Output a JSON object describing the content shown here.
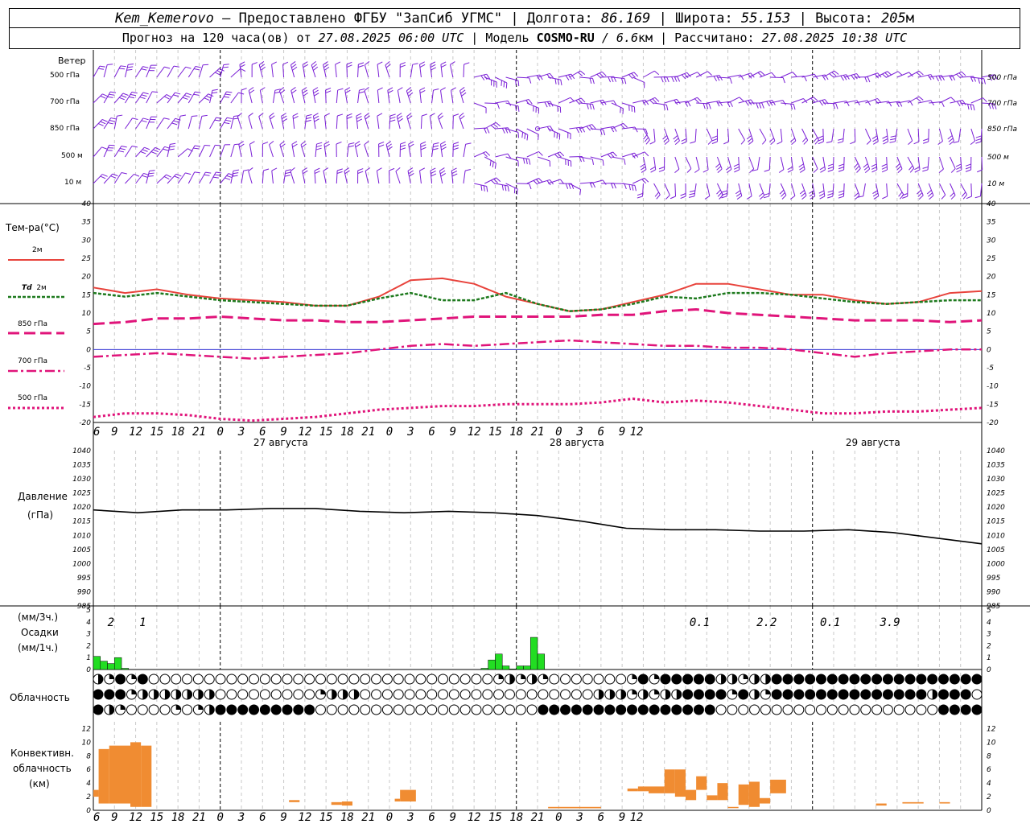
{
  "header": {
    "line1": {
      "station": "Kem_Kemerovo",
      "provider": " — Предоставлено ФГБУ \"ЗапСиб УГМС\" | Долгота: ",
      "lon": "86.169",
      "lat_label": " | Широта: ",
      "lat": "55.153",
      "alt_label": " | Высота: ",
      "alt": "205",
      "alt_unit": "м"
    },
    "line2": {
      "forecast_label": "Прогноз на 120 часа(ов) от ",
      "start": "27.08.2025 06:00 UTC",
      "model_label": " | Модель ",
      "model": "COSMO-RU",
      "res": " / 6.6",
      "res_unit": "км",
      "calc_label": " | Рассчитано: ",
      "calc": "27.08.2025 10:38 UTC"
    }
  },
  "labels": {
    "wind": "Ветер",
    "wind_levels": [
      "500 гПа",
      "700 гПа",
      "850 гПа",
      "500 м",
      "10 м"
    ],
    "temp": "Тем-ра(°C)",
    "t2m": "2м",
    "td": "Td",
    "td2m": "2м",
    "t850": "850 гПа",
    "t700": "700 гПа",
    "t500": "500 гПа",
    "pressure": "Давление",
    "pressure_unit": "(гПа)",
    "precip_unit3": "(мм/3ч.)",
    "precip": "Осадки",
    "precip_unit1": "(мм/1ч.)",
    "cloud": "Облачность",
    "conv1": "Конвективн.",
    "conv2": "облачность",
    "conv3": "(км)"
  },
  "x_ticks": [
    "6",
    "9",
    "12",
    "15",
    "18",
    "21",
    "0",
    "3",
    "6",
    "9",
    "12",
    "15",
    "18",
    "21",
    "0",
    "3",
    "6",
    "9",
    "12",
    "15",
    "18",
    "21",
    "0",
    "3",
    "6",
    "9",
    "12"
  ],
  "dates": [
    "27 августа",
    "28 августа",
    "29 августа"
  ],
  "colors": {
    "wind": "#7a1fd6",
    "t2m": "#e8433c",
    "td": "#1e7a1e",
    "t850": "#e0147a",
    "precip": "#22dd22",
    "conv": "#f08c32",
    "pressure": "#000000"
  },
  "chart_data": [
    {
      "type": "line",
      "title": "Тем-ра(°C)",
      "ylim": [
        -20,
        40
      ],
      "yticks": [
        40,
        35,
        30,
        25,
        20,
        15,
        10,
        5,
        0,
        -5,
        -10,
        -15,
        -20
      ],
      "x_hours": [
        0,
        3,
        6,
        9,
        12,
        15,
        18,
        21,
        24,
        27,
        30,
        33,
        36,
        39,
        42,
        45,
        48,
        51,
        54,
        57,
        60,
        63,
        66,
        69,
        72,
        75,
        78,
        81
      ],
      "series": [
        {
          "name": "2м",
          "values": [
            17,
            15.5,
            16.5,
            15,
            14,
            13.5,
            13,
            12,
            12,
            14.5,
            19,
            19.5,
            18,
            14.5,
            12.5,
            10.5,
            11,
            13,
            15,
            18,
            18,
            16.5,
            15,
            15,
            13.5,
            12.5,
            13,
            15.5,
            16
          ]
        },
        {
          "name": "Td 2м",
          "values": [
            15.5,
            14.5,
            15.5,
            14.5,
            13.5,
            13,
            12.5,
            12,
            12,
            14,
            15.5,
            13.5,
            13.5,
            15.5,
            12.5,
            10.5,
            11,
            12.5,
            14.5,
            14,
            15.5,
            15.5,
            15,
            14,
            13,
            12.5,
            13,
            13.5,
            13.5
          ]
        },
        {
          "name": "850 гПа",
          "values": [
            7,
            7.5,
            8.5,
            8.5,
            9,
            8.5,
            8,
            8,
            7.5,
            7.5,
            8,
            8.5,
            9,
            9,
            9,
            9,
            9.5,
            9.5,
            10.5,
            11,
            10,
            9.5,
            9,
            8.5,
            8,
            8,
            8,
            7.5,
            8
          ]
        },
        {
          "name": "700 гПа",
          "values": [
            -2,
            -1.5,
            -1,
            -1.5,
            -2,
            -2.5,
            -2,
            -1.5,
            -1,
            0,
            1,
            1.5,
            1,
            1.5,
            2,
            2.5,
            2,
            1.5,
            1,
            1,
            0.5,
            0.5,
            0,
            -1,
            -2,
            -1,
            -0.5,
            0,
            0
          ]
        },
        {
          "name": "500 гПа",
          "values": [
            -18.5,
            -17.5,
            -17.5,
            -18,
            -19,
            -19.5,
            -19,
            -18.5,
            -17.5,
            -16.5,
            -16,
            -15.5,
            -15.5,
            -15,
            -15,
            -15,
            -14.5,
            -13.5,
            -14.5,
            -14,
            -14.5,
            -15.5,
            -16.5,
            -17.5,
            -17.5,
            -17,
            -17,
            -16.5,
            -16
          ]
        }
      ]
    },
    {
      "type": "line",
      "title": "Давление (гПа)",
      "ylim": [
        985,
        1040
      ],
      "yticks": [
        1040,
        1035,
        1030,
        1025,
        1020,
        1015,
        1010,
        1005,
        1000,
        995,
        990,
        985
      ],
      "x_hours": [
        0,
        6,
        12,
        18,
        24,
        30,
        36,
        42,
        48,
        54,
        60,
        66,
        72,
        78,
        84,
        90,
        96,
        102,
        108,
        114,
        120
      ],
      "series": [
        {
          "name": "Давление",
          "values": [
            1019,
            1018,
            1019,
            1019,
            1019.5,
            1019.5,
            1018.5,
            1018,
            1018.5,
            1018,
            1017,
            1015,
            1012.5,
            1012,
            1012,
            1011.5,
            1011.5,
            1012,
            1011,
            1009,
            1007
          ]
        }
      ]
    },
    {
      "type": "bar",
      "title": "Осадки",
      "ylim": [
        0,
        5
      ],
      "yticks": [
        5,
        4,
        3,
        2,
        1,
        0
      ],
      "data_labels": [
        "2",
        "1",
        "0.1",
        "2.2",
        "0.1",
        "3.9"
      ],
      "hourly_mm": [
        [
          0,
          1.1
        ],
        [
          1,
          0.7
        ],
        [
          2,
          0.5
        ],
        [
          3,
          1.0
        ],
        [
          4,
          0.1
        ],
        [
          55,
          0.1
        ],
        [
          56,
          0.8
        ],
        [
          57,
          1.3
        ],
        [
          58,
          0.3
        ],
        [
          59,
          0.05
        ],
        [
          60,
          0.3
        ],
        [
          61,
          0.3
        ],
        [
          62,
          2.7
        ],
        [
          63,
          1.3
        ]
      ]
    },
    {
      "type": "table",
      "title": "Облачность",
      "rows": [
        "hqfqfeeeeeeeeeeeeeeeeeeeeeeeeeeeeeeeqhqhqeeeeeeeqfqfffffhhqhhffffffffffffffffffffhqeeeeeeeeeqhqhqhff",
        "fffqhhhhhhheeeeeeeeeqhhheeeeeeeeeeeeeeeeeeeeehhhqhqhhffffqfhqffffffffffffffhfffeeeeeeeeeeeeeeeeeeeee",
        "fhqeeeeqeqhfffffffffeeeeeeeeeeeeeeeeeeeeffffffffffffffffeeeeeeeeeeeeeeeeeeeefffffffeeeeeeeeeeeeee"
      ]
    },
    {
      "type": "bar",
      "title": "Конвективн. облачность (км)",
      "ylim": [
        0,
        13
      ],
      "yticks": [
        12,
        10,
        8,
        6,
        4,
        2,
        0
      ],
      "segments": [
        [
          0,
          1,
          2,
          3
        ],
        [
          1,
          3,
          1,
          9
        ],
        [
          3,
          7,
          1,
          9.5
        ],
        [
          7,
          9,
          0.5,
          10
        ],
        [
          9,
          11,
          0.5,
          9.5
        ],
        [
          37,
          39,
          1.2,
          1.5
        ],
        [
          45,
          47,
          0.8,
          1.2
        ],
        [
          47,
          49,
          0.7,
          1.3
        ],
        [
          57,
          58,
          1.3,
          1.7
        ],
        [
          58,
          61,
          1.3,
          3
        ],
        [
          86,
          96,
          0.3,
          0.5
        ],
        [
          101,
          103,
          2.8,
          3.2
        ],
        [
          103,
          105,
          2.8,
          3.5
        ],
        [
          105,
          108,
          2.5,
          3.5
        ],
        [
          108,
          110,
          2.5,
          6
        ],
        [
          110,
          112,
          2,
          6
        ],
        [
          112,
          114,
          1.5,
          3
        ],
        [
          114,
          116,
          3,
          5
        ],
        [
          116,
          118,
          1.5,
          2.2
        ],
        [
          118,
          120,
          1.5,
          4
        ],
        [
          120,
          122,
          0.5,
          0.5
        ],
        [
          122,
          124,
          0.8,
          3.8
        ],
        [
          124,
          126,
          0.5,
          4.2
        ],
        [
          126,
          128,
          1,
          1.8
        ],
        [
          128,
          131,
          2.5,
          4.5
        ],
        [
          148,
          150,
          0.7,
          1
        ],
        [
          153,
          157,
          1,
          1.2
        ],
        [
          160,
          162,
          1,
          1.2
        ]
      ]
    }
  ]
}
